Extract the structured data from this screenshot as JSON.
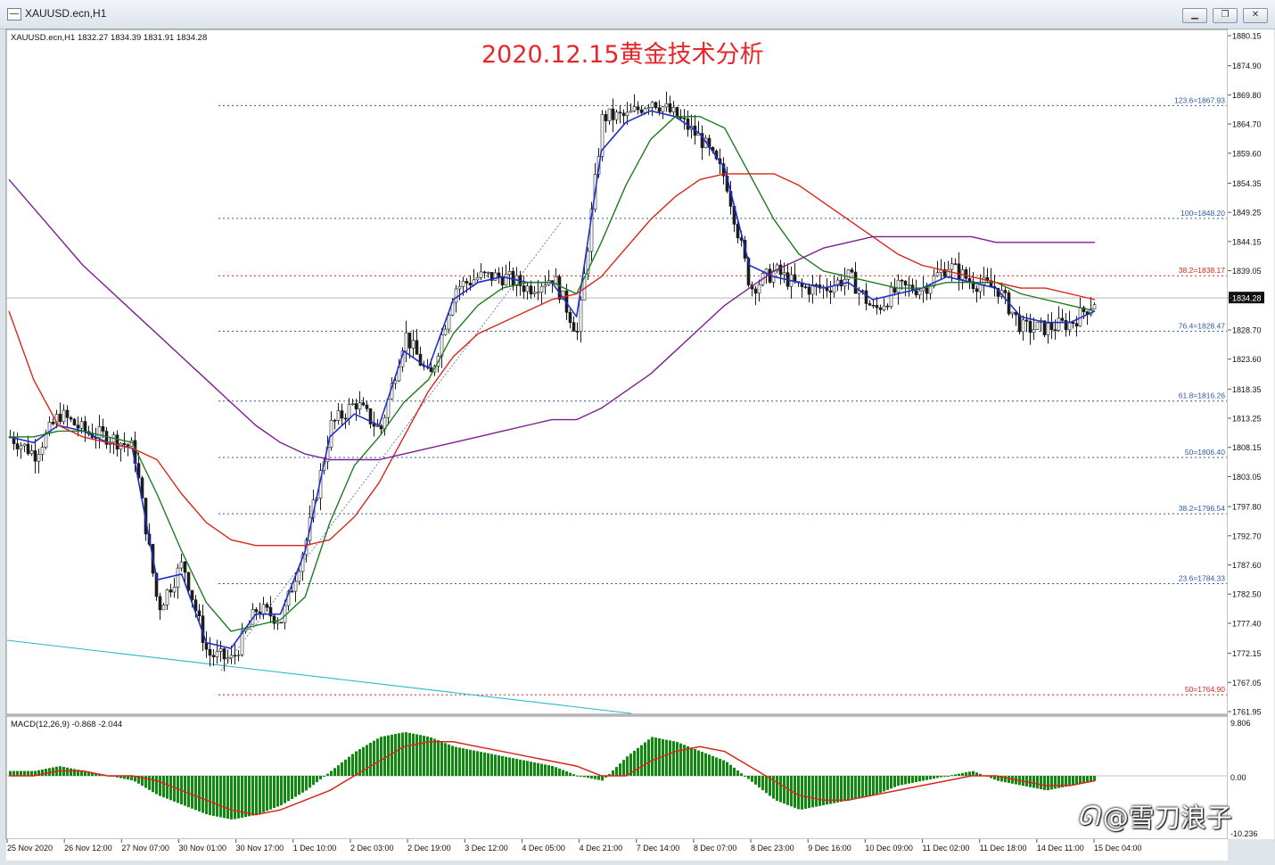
{
  "window": {
    "title": "XAUUSD.ecn,H1",
    "buttons": [
      "▁",
      "❐",
      "✕"
    ]
  },
  "chart_header": {
    "symbol_info": "XAUUSD.ecn,H1  1832.27 1834.39 1831.91 1834.28",
    "headline": "2020.12.15黄金技术分析",
    "headline_color": "#e8262a"
  },
  "colors": {
    "bull_candle": "#1c1c1c",
    "bear_candle": "#1c1c1c",
    "ma_fast": "#1f2fc8",
    "ma_mid": "#1f7a1f",
    "ma_slow": "#d8251b",
    "ma_long": "#7a1f8c",
    "trend_line": "#23b8c8",
    "fib_line": "#2f5aa8",
    "fib_key_line": "#d8251b",
    "macd_hist": "#0f8a0f",
    "macd_signal": "#d8251b"
  },
  "price_axis": {
    "labels": [
      "1880.15",
      "1874.90",
      "1869.80",
      "1864.70",
      "1859.60",
      "1854.35",
      "1849.25",
      "1844.15",
      "1839.05",
      "1834.28",
      "1828.70",
      "1823.60",
      "1818.35",
      "1813.25",
      "1808.15",
      "1803.05",
      "1797.80",
      "1792.70",
      "1787.60",
      "1782.50",
      "1777.40",
      "1772.15",
      "1767.05",
      "1761.95"
    ],
    "current_price": "1834.28"
  },
  "time_axis": {
    "labels": [
      "25 Nov 2020",
      "26 Nov 12:00",
      "27 Nov 07:00",
      "30 Nov 01:00",
      "30 Nov 17:00",
      "1 Dec 10:00",
      "2 Dec 03:00",
      "2 Dec 19:00",
      "3 Dec 12:00",
      "4 Dec 05:00",
      "4 Dec 21:00",
      "7 Dec 14:00",
      "8 Dec 07:00",
      "8 Dec 23:00",
      "9 Dec 16:00",
      "10 Dec 09:00",
      "11 Dec 02:00",
      "11 Dec 18:00",
      "14 Dec 11:00",
      "15 Dec 04:00"
    ]
  },
  "fib_levels": [
    {
      "label": "123.6=1867.93",
      "price": 1867.93,
      "key": false
    },
    {
      "label": "100=1848.20",
      "price": 1848.2,
      "key": false
    },
    {
      "label": "38.2=1838.17",
      "price": 1838.17,
      "key": true
    },
    {
      "label": "76.4=1828.47",
      "price": 1828.47,
      "key": false
    },
    {
      "label": "61.8=1816.26",
      "price": 1816.26,
      "key": false
    },
    {
      "label": "50=1806.40",
      "price": 1806.4,
      "key": false
    },
    {
      "label": "38.2=1796.54",
      "price": 1796.54,
      "key": false
    },
    {
      "label": "23.6=1784.33",
      "price": 1784.33,
      "key": false
    },
    {
      "label": "50=1764.90",
      "price": 1764.9,
      "key": true
    }
  ],
  "macd": {
    "header": "MACD(12,26,9) -0.868 -2.044",
    "axis_labels": [
      "9.806",
      "0.00",
      "-10.236"
    ]
  },
  "chart_data": {
    "type": "candlestick",
    "symbol": "XAUUSD.ecn",
    "timeframe": "H1",
    "last_bar": {
      "open": 1832.27,
      "high": 1834.39,
      "low": 1831.91,
      "close": 1834.28
    },
    "ylim": [
      1761.95,
      1880.15
    ],
    "x": [
      "25 Nov 2020",
      "26 Nov 12:00",
      "27 Nov 07:00",
      "30 Nov 01:00",
      "30 Nov 17:00",
      "1 Dec 10:00",
      "2 Dec 03:00",
      "2 Dec 19:00",
      "3 Dec 12:00",
      "4 Dec 05:00",
      "4 Dec 21:00",
      "7 Dec 14:00",
      "8 Dec 07:00",
      "8 Dec 23:00",
      "9 Dec 16:00",
      "10 Dec 09:00",
      "11 Dec 02:00",
      "11 Dec 18:00",
      "14 Dec 11:00",
      "15 Dec 04:00"
    ],
    "close_path": [
      1810,
      1807,
      1814,
      1811,
      1810,
      1808,
      1780,
      1788,
      1772,
      1771,
      1780,
      1778,
      1792,
      1812,
      1816,
      1811,
      1828,
      1820,
      1836,
      1838,
      1838,
      1836,
      1838,
      1828,
      1866,
      1866,
      1869,
      1866,
      1862,
      1855,
      1836,
      1839,
      1836,
      1836,
      1838,
      1832,
      1836,
      1836,
      1840,
      1837,
      1836,
      1829,
      1829,
      1830,
      1834
    ],
    "series": [
      {
        "name": "MA fast",
        "values": [
          1810,
          1809,
          1812,
          1811,
          1809,
          1808,
          1785,
          1786,
          1774,
          1773,
          1779,
          1779,
          1790,
          1810,
          1814,
          1812,
          1825,
          1822,
          1834,
          1837,
          1838,
          1837,
          1837,
          1831,
          1860,
          1865,
          1867,
          1866,
          1863,
          1857,
          1840,
          1838,
          1837,
          1836,
          1837,
          1834,
          1835,
          1836,
          1838,
          1837,
          1836,
          1831,
          1830,
          1830,
          1832
        ]
      },
      {
        "name": "MA mid",
        "values": [
          1810,
          1810,
          1811,
          1811,
          1810,
          1809,
          1800,
          1790,
          1781,
          1776,
          1777,
          1778,
          1782,
          1795,
          1805,
          1810,
          1816,
          1820,
          1828,
          1833,
          1836,
          1837,
          1837,
          1835,
          1844,
          1854,
          1862,
          1866,
          1866,
          1864,
          1856,
          1848,
          1842,
          1839,
          1838,
          1837,
          1836,
          1836,
          1837,
          1837,
          1837,
          1835,
          1834,
          1833,
          1832
        ]
      },
      {
        "name": "MA slow",
        "values": [
          1832,
          1820,
          1812,
          1810,
          1809,
          1808,
          1806,
          1800,
          1795,
          1792,
          1791,
          1791,
          1791,
          1792,
          1796,
          1802,
          1810,
          1818,
          1824,
          1828,
          1830,
          1832,
          1834,
          1835,
          1838,
          1843,
          1848,
          1852,
          1855,
          1856,
          1856,
          1856,
          1854,
          1851,
          1848,
          1845,
          1842,
          1840,
          1839,
          1838,
          1837,
          1836,
          1836,
          1835,
          1834
        ]
      },
      {
        "name": "MA long",
        "values": [
          1855,
          1850,
          1845,
          1840,
          1836,
          1832,
          1828,
          1824,
          1820,
          1816,
          1812,
          1809,
          1807,
          1806,
          1806,
          1806,
          1807,
          1808,
          1809,
          1810,
          1811,
          1812,
          1813,
          1813,
          1815,
          1818,
          1821,
          1825,
          1829,
          1833,
          1836,
          1839,
          1841,
          1843,
          1844,
          1845,
          1845,
          1845,
          1845,
          1845,
          1844,
          1844,
          1844,
          1844,
          1844
        ]
      }
    ],
    "macd_hist": [
      1,
      1,
      2,
      1,
      0,
      -1,
      -4,
      -6,
      -8,
      -9,
      -8,
      -6,
      -3,
      1,
      5,
      8,
      9,
      8,
      6,
      5,
      4,
      3,
      2,
      0,
      -1,
      4,
      8,
      7,
      5,
      3,
      -1,
      -5,
      -7,
      -6,
      -5,
      -4,
      -2,
      -1,
      0,
      1,
      -1,
      -2,
      -3,
      -2,
      -1
    ],
    "macd_signal_line": [
      0,
      0,
      1,
      1,
      0,
      0,
      -1,
      -3,
      -5,
      -7,
      -8,
      -7,
      -5,
      -3,
      0,
      3,
      6,
      7,
      7,
      6,
      5,
      4,
      3,
      2,
      0,
      0,
      3,
      5,
      6,
      5,
      2,
      -1,
      -4,
      -5,
      -5,
      -4,
      -3,
      -2,
      -1,
      0,
      0,
      -1,
      -2,
      -2,
      -1
    ]
  }
}
